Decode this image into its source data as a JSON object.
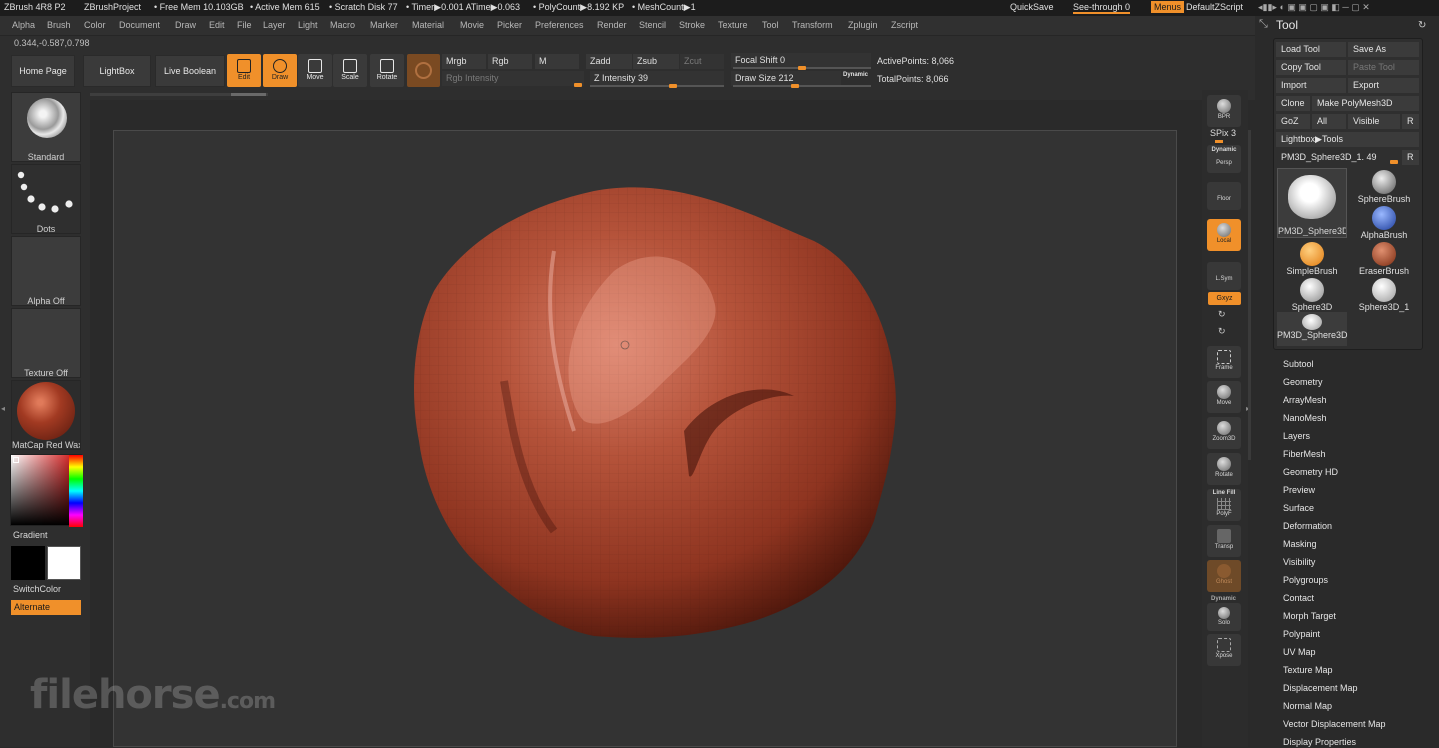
{
  "titlebar": {
    "app": "ZBrush 4R8 P2",
    "project": "ZBrushProject",
    "free_mem": "• Free Mem 10.103GB",
    "active_mem": "• Active Mem 615",
    "scratch": "• Scratch Disk 77",
    "timer": "• Timer▶0.001 ATime▶0.063",
    "polycount": "• PolyCount▶8.192 KP",
    "meshcount": "• MeshCount▶1",
    "quicksave": "QuickSave",
    "see_through": "See-through  0",
    "menus": "Menus",
    "script": "DefaultZScript"
  },
  "menus": [
    "Alpha",
    "Brush",
    "Color",
    "Document",
    "Draw",
    "Edit",
    "File",
    "Layer",
    "Light",
    "Macro",
    "Marker",
    "Material",
    "Movie",
    "Picker",
    "Preferences",
    "Render",
    "Stencil",
    "Stroke",
    "Texture",
    "Tool",
    "Transform",
    "Zplugin",
    "Zscript"
  ],
  "coords": "0.344,-0.587,0.798",
  "nav": {
    "home": "Home Page",
    "lightbox": "LightBox",
    "live_boolean": "Live Boolean"
  },
  "tools": {
    "edit": "Edit",
    "draw": "Draw",
    "move": "Move",
    "scale": "Scale",
    "rotate": "Rotate"
  },
  "params": {
    "mrgb": "Mrgb",
    "rgb": "Rgb",
    "m": "M",
    "rgb_intensity": "Rgb Intensity",
    "zadd": "Zadd",
    "zsub": "Zsub",
    "zcut": "Zcut",
    "z_intensity": "Z Intensity 39",
    "focal_shift": "Focal Shift 0",
    "draw_size": "Draw Size 212",
    "dynamic": "Dynamic",
    "active_points": "ActivePoints: 8,066",
    "total_points": "TotalPoints: 8,066"
  },
  "left": {
    "brush": "Standard",
    "stroke": "Dots",
    "alpha": "Alpha Off",
    "texture": "Texture Off",
    "material": "MatCap Red Wax",
    "gradient": "Gradient",
    "switch": "SwitchColor",
    "alternate": "Alternate"
  },
  "right": {
    "bpr": "BPR",
    "spix": "SPix 3",
    "dynamic": "Dynamic",
    "persp": "Persp",
    "floor": "Floor",
    "local": "Local",
    "lsym": "L.Sym",
    "xyz": "Gxyz",
    "frame": "Frame",
    "move": "Move",
    "zoom3d": "Zoom3D",
    "rotate": "Rotate",
    "linefill": "Line Fill",
    "polyf": "PolyF",
    "transp": "Transp",
    "ghost": "Ghost",
    "dynamic2": "Dynamic",
    "solo": "Solo",
    "xpose": "Xpose"
  },
  "toolpanel": {
    "title": "Tool",
    "load": "Load Tool",
    "save_as": "Save As",
    "copy": "Copy Tool",
    "paste": "Paste Tool",
    "import": "Import",
    "export": "Export",
    "clone": "Clone",
    "make_poly": "Make PolyMesh3D",
    "goz": "GoZ",
    "all": "All",
    "visible": "Visible",
    "r": "R",
    "lightbox_tools": "Lightbox▶Tools",
    "current": "PM3D_Sphere3D_1. 49",
    "r2": "R",
    "grid": [
      "PM3D_Sphere3D",
      "SphereBrush",
      "AlphaBrush",
      "SimpleBrush",
      "EraserBrush",
      "Sphere3D",
      "Sphere3D_1",
      "PM3D_Sphere3D"
    ],
    "sections": [
      "Subtool",
      "Geometry",
      "ArrayMesh",
      "NanoMesh",
      "Layers",
      "FiberMesh",
      "Geometry HD",
      "Preview",
      "Surface",
      "Deformation",
      "Masking",
      "Visibility",
      "Polygroups",
      "Contact",
      "Morph Target",
      "Polypaint",
      "UV Map",
      "Texture Map",
      "Displacement Map",
      "Normal Map",
      "Vector Displacement Map",
      "Display Properties"
    ]
  },
  "watermark": {
    "main": "filehorse",
    "suffix": ".com"
  },
  "colors": {
    "accent": "#f0902a",
    "bg": "#2a2a2a",
    "clay": "#a8452e"
  }
}
